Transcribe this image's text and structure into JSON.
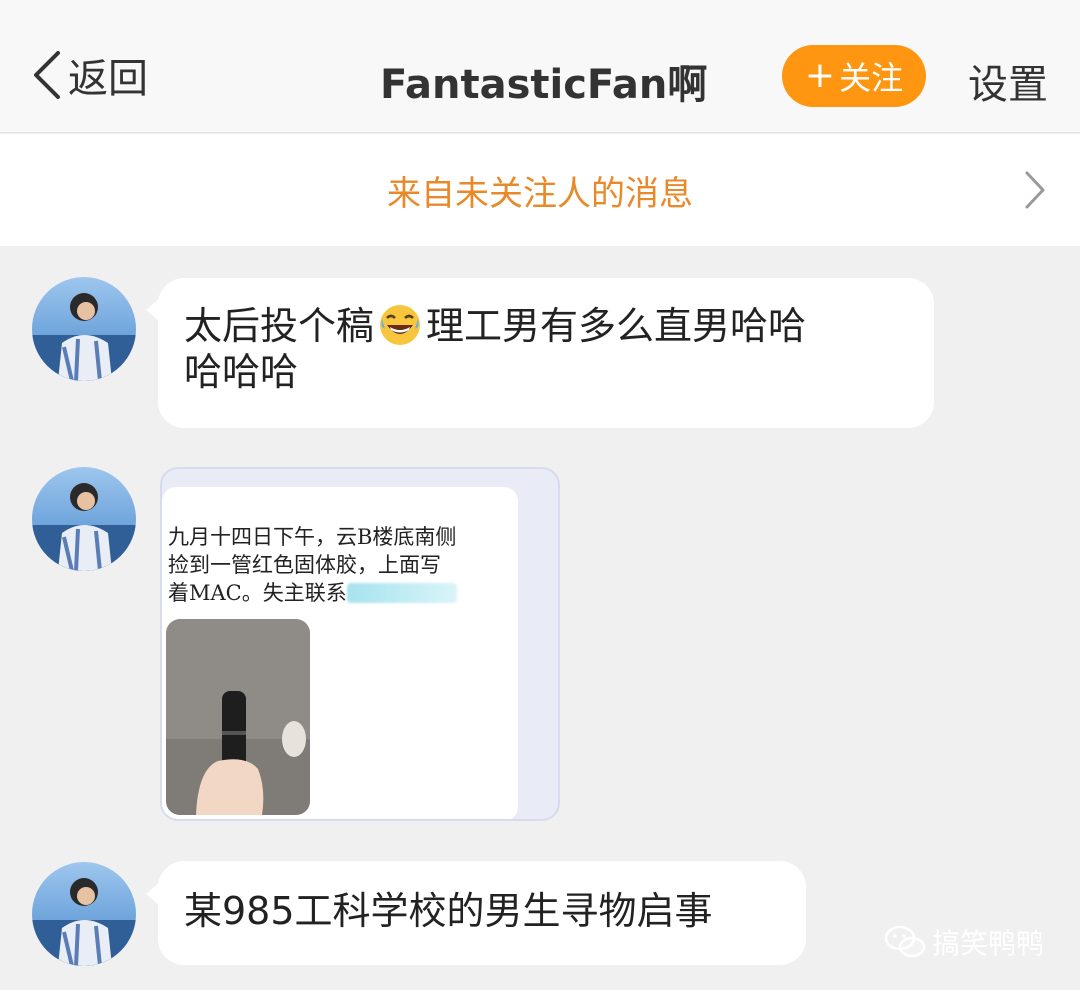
{
  "navbar": {
    "back_label": "返回",
    "title": "FantasticFan啊",
    "follow_label": "关注",
    "follow_plus": "+",
    "settings_label": "设置"
  },
  "notice": {
    "text": "来自未关注人的消息"
  },
  "messages": [
    {
      "type": "text",
      "line1": "太后投个稿",
      "line1_after_emoji": "理工男有多么直男哈哈",
      "line2": "哈哈哈"
    },
    {
      "type": "image",
      "image_text": "九月十四日下午，云B楼底南侧\n捡到一管红色固体胶，上面写\n着MAC。失主联系",
      "image_caption_blurred": "phone-number-redacted"
    },
    {
      "type": "text",
      "text": "某985工科学校的男生寻物启事"
    }
  ],
  "watermark": {
    "text": "搞笑鸭鸭"
  },
  "colors": {
    "accent": "#ff9612",
    "notice": "#e8892a",
    "background": "#f0f0f0"
  }
}
